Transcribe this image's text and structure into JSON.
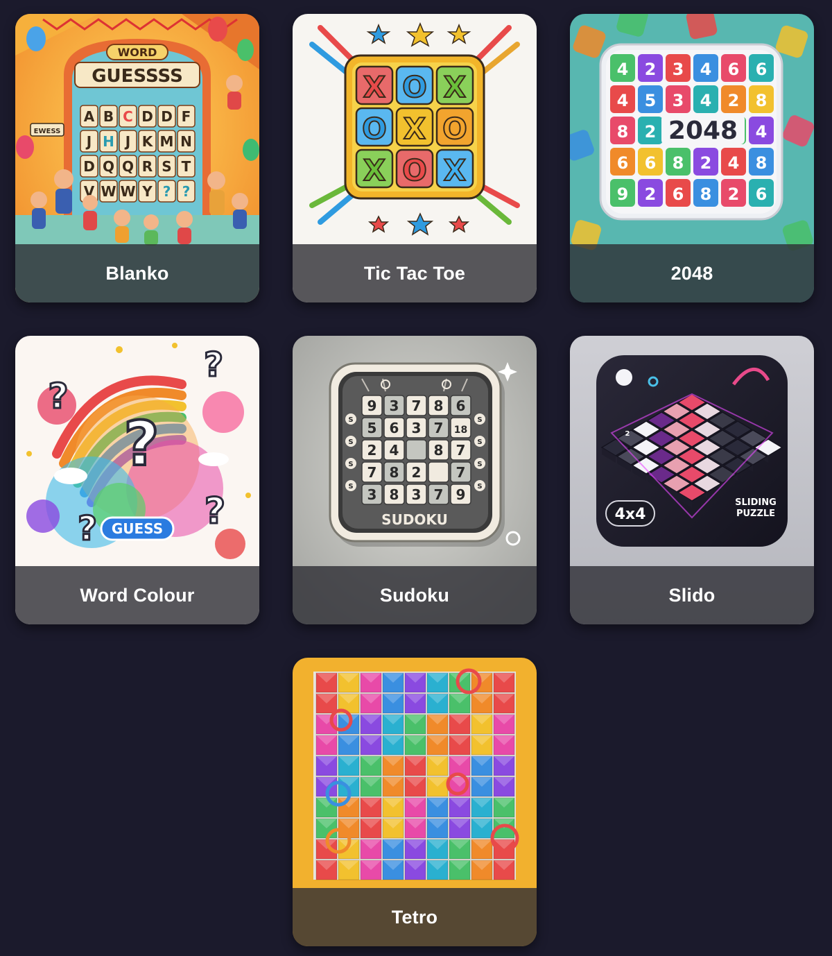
{
  "games": [
    {
      "label": "Blanko",
      "art_text": {
        "badge": "WORD",
        "headline": "GUESSSS",
        "sign": "EWESS",
        "rows": [
          [
            "A",
            "B",
            "C",
            "D",
            "D",
            "F"
          ],
          [
            "J",
            "H",
            "J",
            "K",
            "M",
            "N"
          ],
          [
            "D",
            "Q",
            "Q",
            "R",
            "S",
            "T"
          ],
          [
            "V",
            "W",
            "W",
            "Y",
            "?",
            "?"
          ]
        ]
      }
    },
    {
      "label": "Tic Tac Toe",
      "art_text": {
        "cells": [
          "X",
          "O",
          "X",
          "O",
          "X",
          "O",
          "X",
          "O",
          "X"
        ]
      }
    },
    {
      "label": "2048",
      "art_text": {
        "center": "2048",
        "rows": [
          [
            "4",
            "2",
            "3",
            "4",
            "6",
            "6"
          ],
          [
            "4",
            "5",
            "3",
            "4",
            "2",
            "8"
          ],
          [
            "8",
            "2",
            "",
            "",
            "",
            "4"
          ],
          [
            "6",
            "6",
            "8",
            "2",
            "4",
            "8"
          ],
          [
            "9",
            "2",
            "6",
            "8",
            "2",
            "6"
          ]
        ]
      }
    },
    {
      "label": "Word Colour",
      "art_text": {
        "badge": "GUESS",
        "marks": [
          "?",
          "?",
          "?",
          "?",
          "?"
        ]
      }
    },
    {
      "label": "Sudoku",
      "art_text": {
        "title": "SUDOKU",
        "rows": [
          [
            "9",
            "3",
            "7",
            "8",
            "6"
          ],
          [
            "5",
            "6",
            "3",
            "7",
            "18"
          ],
          [
            "2",
            "4",
            "",
            "8",
            "7"
          ],
          [
            "7",
            "8",
            "2",
            "",
            "7"
          ],
          [
            "3",
            "8",
            "3",
            "7",
            "9"
          ]
        ],
        "side": [
          "S",
          "S",
          "S",
          "S"
        ]
      }
    },
    {
      "label": "Slido",
      "art_text": {
        "badge": "4x4",
        "caption_1": "SLIDING",
        "caption_2": "PUZZLE",
        "tile": "2"
      }
    },
    {
      "label": "Tetro",
      "art_text": {}
    }
  ]
}
